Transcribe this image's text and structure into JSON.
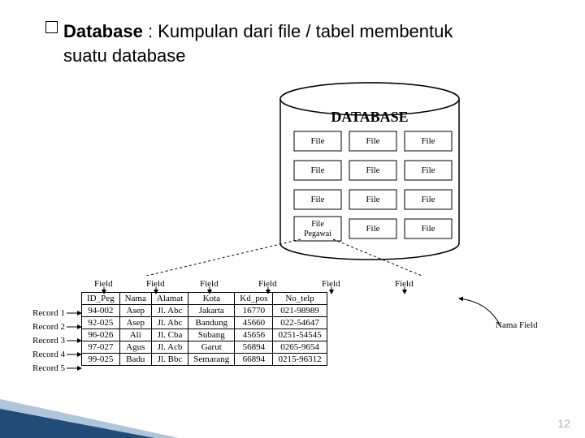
{
  "heading": {
    "bold": "Database",
    "rest": " : Kumpulan dari file / tabel membentuk suatu database"
  },
  "page_number": "12",
  "cylinder": {
    "title": "DATABASE",
    "rows": [
      [
        "File",
        "File",
        "File"
      ],
      [
        "File",
        "File",
        "File"
      ],
      [
        "File",
        "File",
        "File"
      ],
      [
        "File Pegawai",
        "File",
        "File"
      ]
    ]
  },
  "field_label": "Field",
  "nama_field_label": "Nama Field",
  "record_labels": [
    "Record 1",
    "Record 2",
    "Record 3",
    "Record 4",
    "Record 5"
  ],
  "table": {
    "headers": [
      "ID_Peg",
      "Nama",
      "Alamat",
      "Kota",
      "Kd_pos",
      "No_telp"
    ],
    "rows": [
      [
        "94-002",
        "Asep",
        "Jl. Abc",
        "Jakarta",
        "16770",
        "021-98989"
      ],
      [
        "92-025",
        "Asep",
        "Jl. Abc",
        "Bandung",
        "45660",
        "022-54647"
      ],
      [
        "96-026",
        "Ali",
        "Jl. Cba",
        "Subang",
        "45656",
        "0251-54545"
      ],
      [
        "97-027",
        "Agus",
        "Jl. Acb",
        "Garut",
        "56894",
        "0265-9654"
      ],
      [
        "99-025",
        "Badu",
        "Jl. Bbc",
        "Semarang",
        "66894",
        "0215-96312"
      ]
    ]
  }
}
